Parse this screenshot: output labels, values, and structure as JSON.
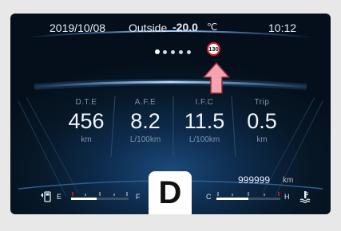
{
  "status_bar": {
    "date": "2019/10/08",
    "outside_label": "Outside",
    "outside_temp": "-20.0",
    "temp_unit": "℃",
    "time": "10:12"
  },
  "page_indicator": {
    "count": 5,
    "active_index": 0
  },
  "speed_limit": {
    "value": "130",
    "icon": "speed-limit-sign-icon",
    "ring_color": "#d61f26"
  },
  "arrow": {
    "icon": "up-arrow-icon",
    "color": "#f5a3b0"
  },
  "info_columns": [
    {
      "label": "D.T.E",
      "value": "456",
      "unit": "km"
    },
    {
      "label": "A.F.E",
      "value": "8.2",
      "unit": "L/100km"
    },
    {
      "label": "I.F.C",
      "value": "11.5",
      "unit": "L/100km"
    },
    {
      "label": "Trip",
      "value": "0.5",
      "unit": "km"
    }
  ],
  "odometer": {
    "value": "999999",
    "unit": "km"
  },
  "gear": "D",
  "fuel_gauge": {
    "empty_label": "E",
    "full_label": "F",
    "level": 0.45,
    "icon": "fuel-pump-icon"
  },
  "temp_gauge": {
    "cold_label": "C",
    "hot_label": "H",
    "level": 0.5,
    "icon": "coolant-temperature-icon"
  },
  "colors": {
    "accent": "#4aa3ff",
    "warning": "#d61f26"
  }
}
